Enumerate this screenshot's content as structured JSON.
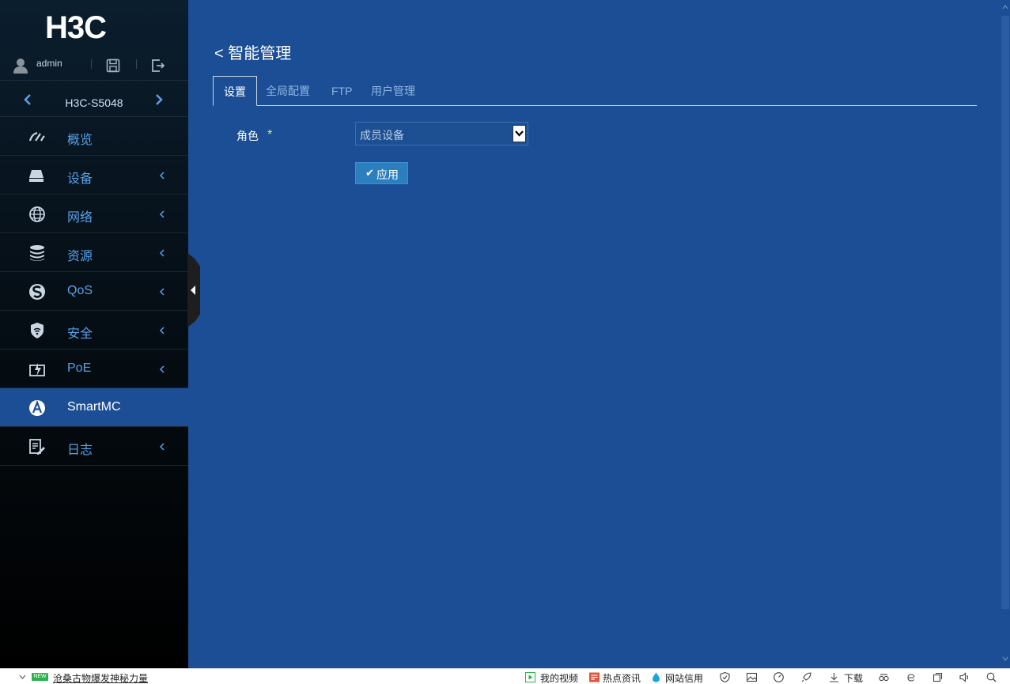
{
  "brand": {
    "logo_text": "H3C"
  },
  "user": {
    "name": "admin"
  },
  "device": {
    "name": "H3C-S5048"
  },
  "menu": [
    {
      "label": "概览",
      "icon": "dashboard-icon",
      "has_arrow": false
    },
    {
      "label": "设备",
      "icon": "device-icon",
      "has_arrow": true
    },
    {
      "label": "网络",
      "icon": "globe-icon",
      "has_arrow": true
    },
    {
      "label": "资源",
      "icon": "database-icon",
      "has_arrow": true
    },
    {
      "label": "QoS",
      "icon": "qos-icon",
      "has_arrow": true
    },
    {
      "label": "安全",
      "icon": "shield-icon",
      "has_arrow": true
    },
    {
      "label": "PoE",
      "icon": "poe-icon",
      "has_arrow": true
    },
    {
      "label": "SmartMC",
      "icon": "smartmc-icon",
      "has_arrow": false,
      "active": true
    },
    {
      "label": "日志",
      "icon": "log-icon",
      "has_arrow": true
    }
  ],
  "page": {
    "back_title": "< 智能管理",
    "tabs": [
      "设置",
      "全局配置",
      "FTP",
      "用户管理"
    ],
    "active_tab": "设置"
  },
  "form": {
    "role_label": "角色",
    "required_mark": "*",
    "role_value": "成员设备",
    "apply_check": "✔",
    "apply_label": "应用"
  },
  "statusbar": {
    "new_badge": "NEW",
    "news": "沧桑古物爆发神秘力量",
    "my_video": "我的视频",
    "hot_news": "热点资讯",
    "site_credit": "网站信用",
    "download": "下载"
  },
  "colors": {
    "main_bg": "#1c4e95",
    "sidebar_bg": "#000000",
    "menu_text": "#5aa0e6",
    "apply_btn": "#2c7fbf",
    "required": "#f2e24b"
  }
}
